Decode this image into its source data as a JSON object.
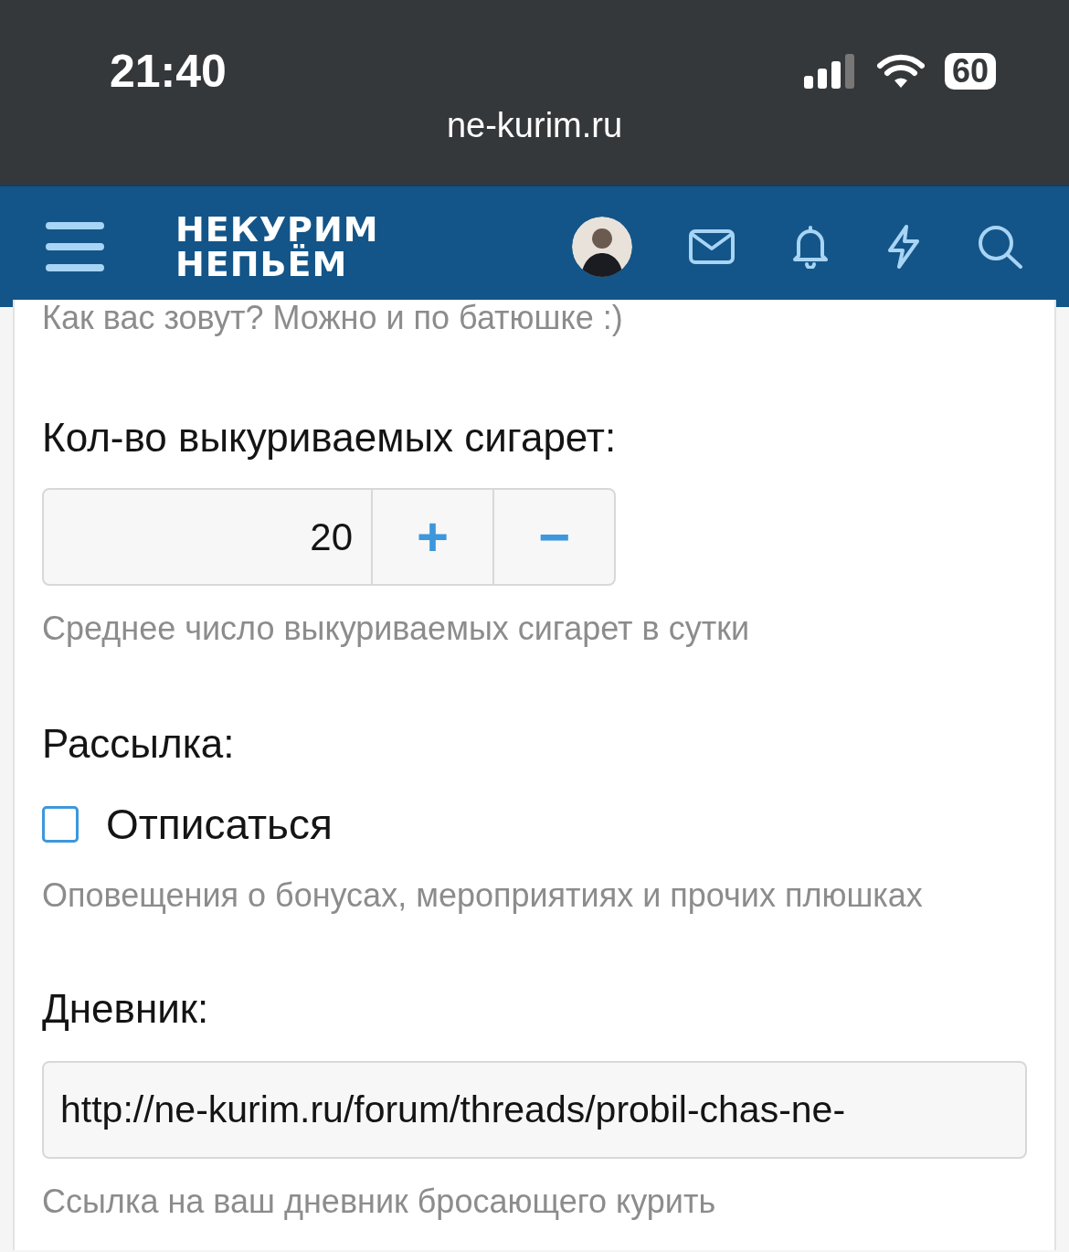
{
  "status_bar": {
    "time": "21:40",
    "battery": "60"
  },
  "browser": {
    "url": "ne-kurim.ru"
  },
  "header": {
    "logo": [
      "НЕКУРИМ",
      "НЕПЬЁМ"
    ]
  },
  "form": {
    "name_hint": "Как вас зовут? Можно и по батюшке :)",
    "cigarettes": {
      "label": "Кол-во выкуриваемых сигарет:",
      "value": "20",
      "plus": "+",
      "minus": "−",
      "hint": "Среднее число выкуриваемых сигарет в сутки"
    },
    "newsletter": {
      "label": "Рассылка:",
      "checkbox": {
        "label": "Отписаться",
        "checked": false
      },
      "hint": "Оповещения о бонусах, мероприятиях и прочих плюшках"
    },
    "diary": {
      "label": "Дневник:",
      "value": "http://ne-kurim.ru/forum/threads/probil-chas-ne-",
      "hint": "Ссылка на ваш дневник бросающего курить"
    }
  }
}
